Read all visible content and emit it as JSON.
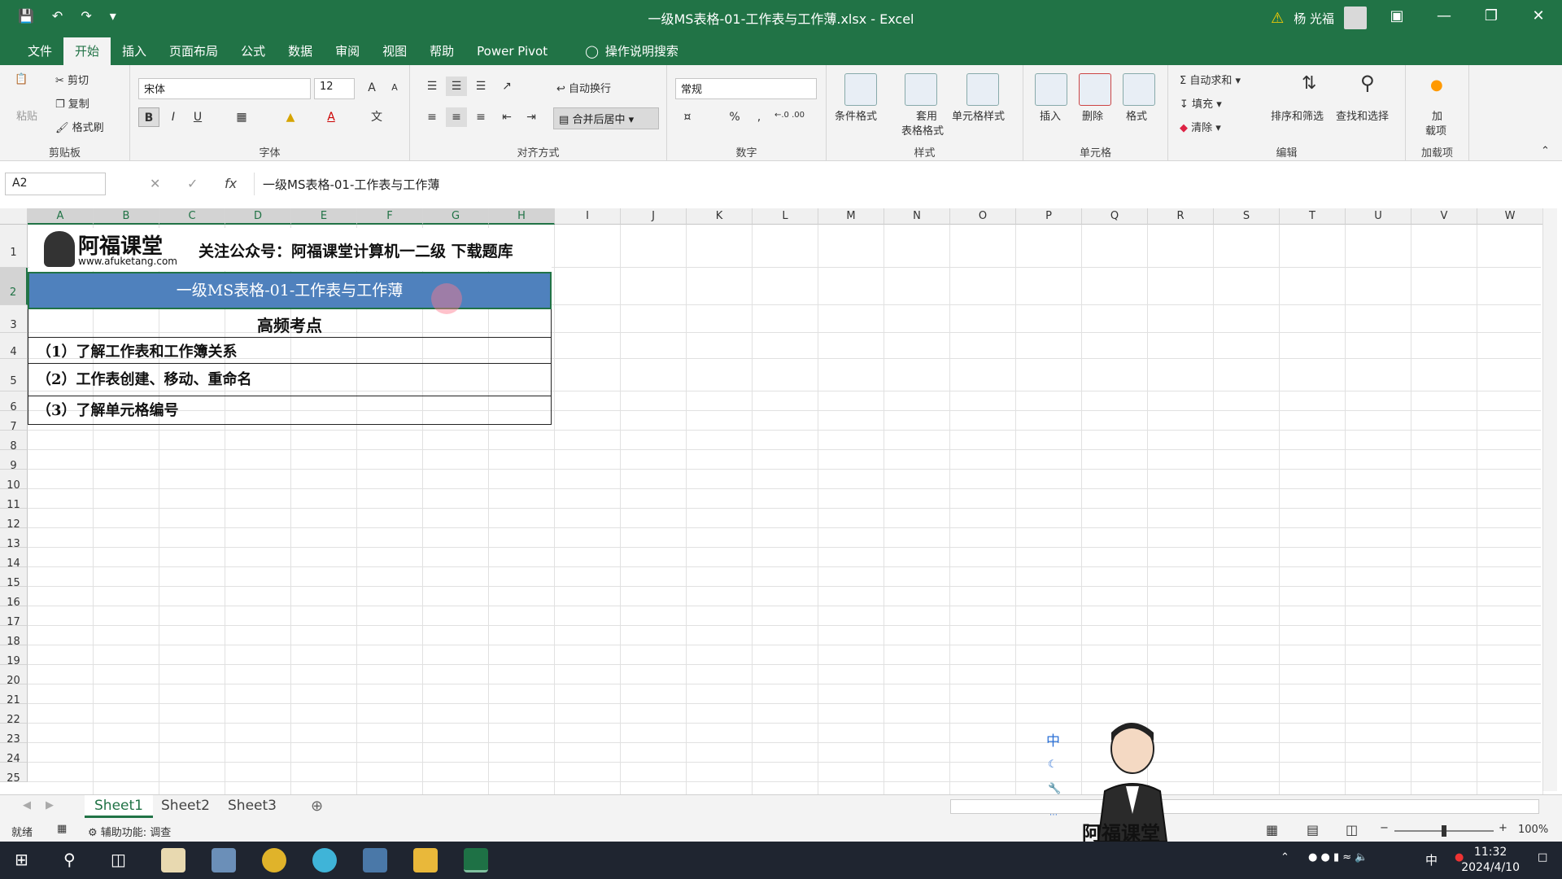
{
  "window": {
    "title": "一级MS表格-01-工作表与工作薄.xlsx  -  Excel",
    "user": "杨 光福"
  },
  "menu": {
    "tabs": [
      "文件",
      "开始",
      "插入",
      "页面布局",
      "公式",
      "数据",
      "审阅",
      "视图",
      "帮助",
      "Power Pivot"
    ],
    "active": "开始",
    "tell_me": "操作说明搜索"
  },
  "ribbon": {
    "clipboard": {
      "paste": "粘贴",
      "cut": "剪切",
      "copy": "复制",
      "format_painter": "格式刷",
      "label": "剪贴板"
    },
    "font": {
      "name": "宋体",
      "size": "12",
      "label": "字体",
      "grow": "A",
      "shrink": "A",
      "bold": "B",
      "italic": "I",
      "underline": "U",
      "font_color": "A"
    },
    "alignment": {
      "wrap": "自动换行",
      "merge": "合并后居中",
      "label": "对齐方式"
    },
    "number": {
      "format": "常规",
      "percent": "%",
      "comma": ",",
      "inc_decimal": "←.0 .00",
      "dec_decimal": ".00 →.0",
      "label": "数字"
    },
    "styles": {
      "conditional": "条件格式",
      "table_format_1": "套用",
      "table_format_2": "表格格式",
      "cell_styles": "单元格样式",
      "label": "样式"
    },
    "cells": {
      "insert": "插入",
      "delete": "删除",
      "format": "格式",
      "label": "单元格"
    },
    "editing": {
      "autosum": "自动求和",
      "fill": "填充",
      "clear": "清除",
      "sort": "排序和筛选",
      "find": "查找和选择",
      "label": "编辑"
    },
    "addins": {
      "btn_1": "加",
      "btn_2": "载项",
      "label": "加载项"
    }
  },
  "formula_bar": {
    "name_box": "A2",
    "fx": "fx",
    "content": "一级MS表格-01-工作表与工作薄"
  },
  "columns": [
    "A",
    "B",
    "C",
    "D",
    "E",
    "F",
    "G",
    "H",
    "I",
    "J",
    "K",
    "L",
    "M",
    "N",
    "O",
    "P",
    "Q",
    "R",
    "S",
    "T",
    "U",
    "V",
    "W"
  ],
  "rows": [
    "1",
    "2",
    "3",
    "4",
    "5",
    "6",
    "7",
    "8",
    "9",
    "10",
    "11",
    "12",
    "13",
    "14",
    "15",
    "16",
    "17",
    "18",
    "19",
    "20",
    "21",
    "22",
    "23",
    "24",
    "25"
  ],
  "sheet": {
    "banner_logo": "阿福课堂",
    "banner_url": "www.afuketang.com",
    "banner_text": "关注公众号：阿福课堂计算机一二级  下载题库",
    "row2": "一级MS表格-01-工作表与工作薄",
    "row3": "高频考点",
    "row4": "（1）了解工作表和工作簿关系",
    "row5": "（2）工作表创建、移动、重命名",
    "row6": "（3）了解单元格编号"
  },
  "sheet_tabs": [
    "Sheet1",
    "Sheet2",
    "Sheet3"
  ],
  "status": {
    "ready": "就绪",
    "accessibility": "辅助功能: 调查",
    "zoom": "100%"
  },
  "ime": {
    "lang": "中"
  },
  "watermark": "阿福课堂",
  "taskbar": {
    "time": "11:32",
    "date": "2024/4/10",
    "ime": "中"
  },
  "colors": {
    "excel_green": "#217346",
    "selection_fill": "#4f81bd"
  }
}
